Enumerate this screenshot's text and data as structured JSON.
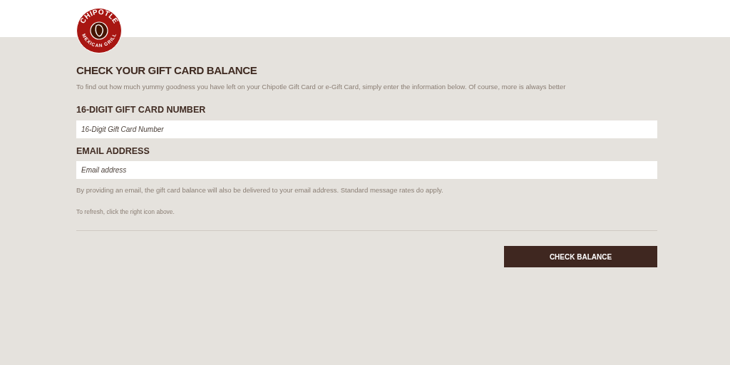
{
  "logo": {
    "top_text": "CHIPOTLE",
    "bottom_text": "MEXICAN GRILL"
  },
  "heading": "CHECK YOUR GIFT CARD BALANCE",
  "intro": "To find out how much yummy goodness you have left on your Chipotle Gift Card or e-Gift Card, simply enter the information below. Of course, more is always better",
  "fields": [
    {
      "label": "16-DIGIT GIFT CARD NUMBER",
      "placeholder": "16-Digit Gift Card Number"
    },
    {
      "label": "EMAIL ADDRESS",
      "placeholder": "Email address"
    }
  ],
  "email_note": "By providing an email, the gift card balance will also be delivered to your email address. Standard message rates do apply.",
  "refresh_note": "To refresh, click the right icon above.",
  "submit_button": "CHECK BALANCE"
}
